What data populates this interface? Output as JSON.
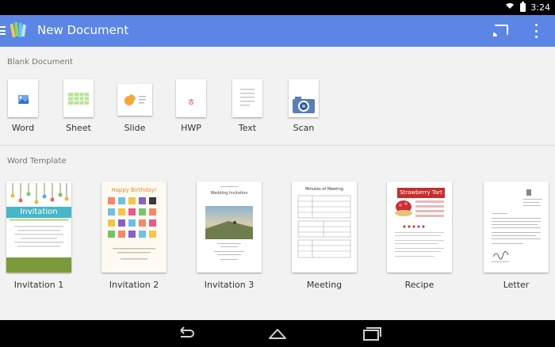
{
  "status_bar": {
    "time": "3:24"
  },
  "app_bar": {
    "title": "New Document"
  },
  "sections": {
    "blank": "Blank Document",
    "template": "Word Template"
  },
  "blank_documents": [
    {
      "label": "Word",
      "icon": "word-doc-icon"
    },
    {
      "label": "Sheet",
      "icon": "sheet-doc-icon"
    },
    {
      "label": "Slide",
      "icon": "slide-doc-icon"
    },
    {
      "label": "HWP",
      "icon": "hwp-doc-icon"
    },
    {
      "label": "Text",
      "icon": "text-doc-icon"
    },
    {
      "label": "Scan",
      "icon": "scan-camera-icon"
    }
  ],
  "word_templates": [
    {
      "label": "Invitation 1",
      "heading": "Invitation"
    },
    {
      "label": "Invitation 2",
      "heading": "Happy Birthday!"
    },
    {
      "label": "Invitation 3",
      "heading": "Wedding Invitation"
    },
    {
      "label": "Meeting",
      "heading": "Minutes of Meeting"
    },
    {
      "label": "Recipe",
      "heading": "Strawberry Tart"
    },
    {
      "label": "Letter",
      "heading": ""
    }
  ],
  "nav_bar": {
    "icons": [
      "back-icon",
      "home-icon",
      "recents-icon"
    ]
  },
  "colors": {
    "accent": "#5b86e5",
    "background": "#f2f2f2"
  }
}
